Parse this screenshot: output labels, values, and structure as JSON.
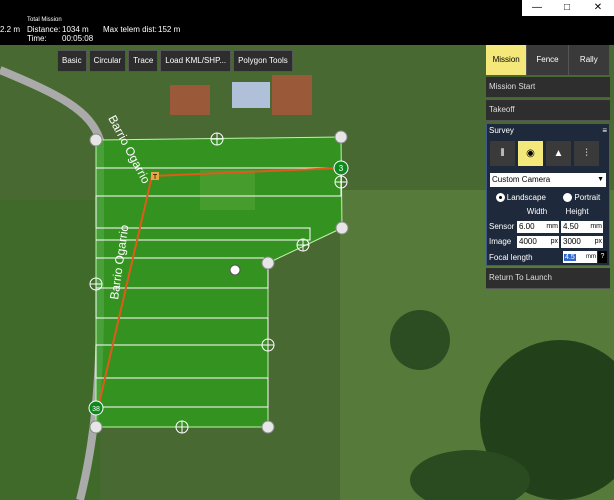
{
  "status": {
    "altitude_partial": "2.2 m",
    "total_mission_label": "Total Mission",
    "distance_label": "Distance:",
    "distance_value": "1034 m",
    "time_label": "Time:",
    "time_value": "00:05:08",
    "max_telem_label": "Max telem dist:",
    "max_telem_value": "152 m"
  },
  "window": {
    "minimize": "—",
    "maximize": "□",
    "close": "✕"
  },
  "toolbar": {
    "basic": "Basic",
    "circular": "Circular",
    "trace": "Trace",
    "load_kml": "Load KML/SHP...",
    "polygon_tools": "Polygon Tools"
  },
  "map": {
    "road_label_1": "Barrio Ogarrio",
    "road_label_2": "Barrio Ogarrio",
    "start_marker": "T",
    "waypoint_3": "3",
    "waypoint_38": "38"
  },
  "panel": {
    "tabs": [
      "Mission",
      "Fence",
      "Rally"
    ],
    "mission_start": "Mission Start",
    "takeoff": "Takeoff",
    "survey_title": "Survey",
    "camera_select": "Custom Camera",
    "landscape": "Landscape",
    "portrait": "Portrait",
    "width_label": "Width",
    "height_label": "Height",
    "sensor_label": "Sensor",
    "sensor_width": "6.00",
    "sensor_width_unit": "mm",
    "sensor_height": "4.50",
    "sensor_height_unit": "mm",
    "image_label": "Image",
    "image_width": "4000",
    "image_width_unit": "px",
    "image_height": "3000",
    "image_height_unit": "px",
    "focal_label": "Focal length",
    "focal_value": "4.5",
    "focal_unit": "mm",
    "help": "?",
    "return_to_launch": "Return To Launch"
  },
  "colors": {
    "survey_fill": "#2e9e1c",
    "active_tab": "#f5e87a",
    "flight_path": "#e05a1a"
  }
}
